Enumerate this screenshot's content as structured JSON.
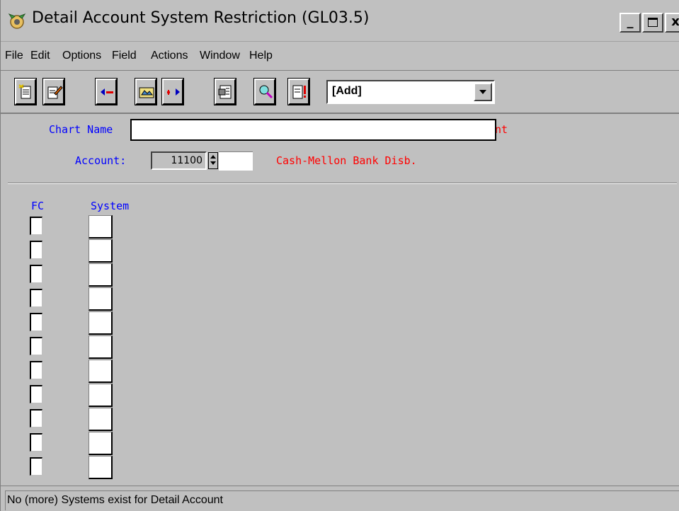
{
  "window": {
    "title": "Detail Account System Restriction (GL03.5)",
    "minimize_glyph": "_",
    "close_glyph": "x"
  },
  "menu": {
    "items": [
      {
        "label": "File"
      },
      {
        "label": "Edit"
      },
      {
        "label": "Options"
      },
      {
        "label": "Field"
      },
      {
        "label": "Actions"
      },
      {
        "label": "Window"
      },
      {
        "label": "Help"
      }
    ]
  },
  "toolbar": {
    "buttons": [
      "new-document-icon",
      "edit-document-icon",
      "previous-icon",
      "open-folder-icon",
      "next-icon",
      "properties-icon",
      "find-icon",
      "alert-icon"
    ],
    "mode_value": "[Add]"
  },
  "form": {
    "chart_name_label": "Chart Name",
    "chart_name_value": "",
    "chart_suffix": "nt",
    "account_label": "Account:",
    "account_value": "11100",
    "account_description": "Cash-Mellon Bank Disb.",
    "fc_header": "FC",
    "system_header": "System"
  },
  "status": {
    "message": "No (more) Systems exist for Detail Account"
  },
  "colors": {
    "background": "#c0c0c0",
    "label_blue": "#0000ff",
    "label_red": "#ff0000"
  }
}
